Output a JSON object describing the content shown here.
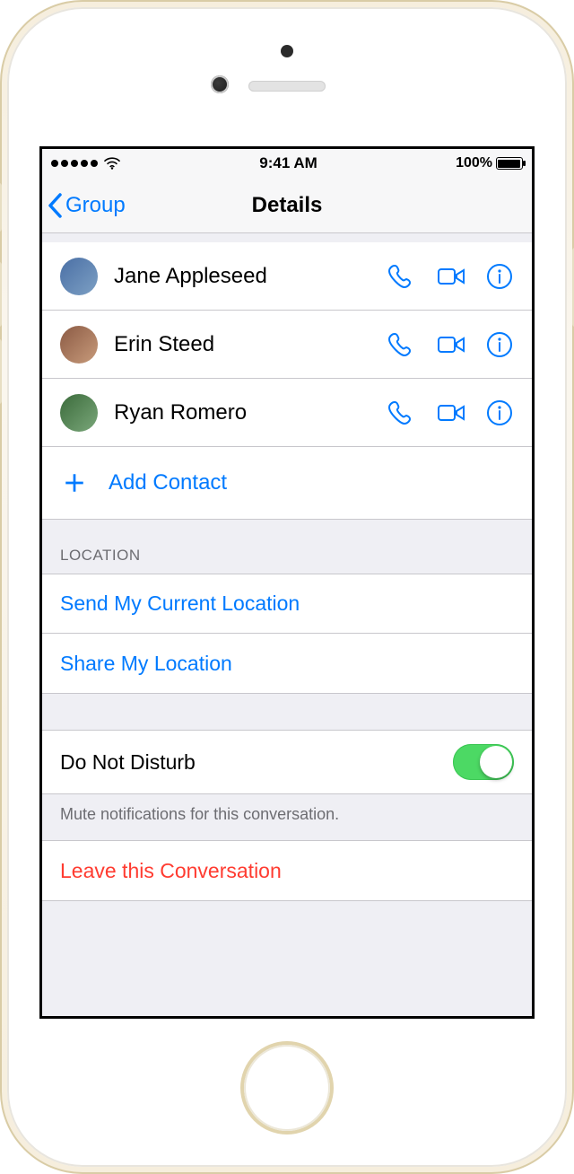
{
  "status": {
    "time": "9:41 AM",
    "battery_pct": "100%"
  },
  "nav": {
    "back_label": "Group",
    "title": "Details"
  },
  "contacts": [
    {
      "name": "Jane Appleseed"
    },
    {
      "name": "Erin Steed"
    },
    {
      "name": "Ryan Romero"
    }
  ],
  "add_contact_label": "Add Contact",
  "location": {
    "header": "LOCATION",
    "send_current": "Send My Current Location",
    "share": "Share My Location"
  },
  "dnd": {
    "label": "Do Not Disturb",
    "enabled": true,
    "footer": "Mute notifications for this conversation."
  },
  "leave_label": "Leave this Conversation",
  "colors": {
    "tint": "#007aff",
    "danger": "#ff3b30",
    "switch_on": "#4cd964"
  }
}
